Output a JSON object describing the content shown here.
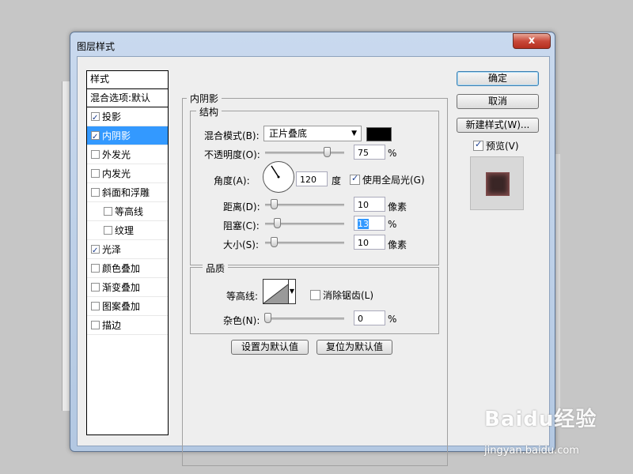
{
  "window": {
    "title": "图层样式",
    "close_label": "x"
  },
  "styles": {
    "header": "样式",
    "blend_options": "混合选项:默认",
    "items": [
      {
        "label": "投影",
        "checked": true
      },
      {
        "label": "内阴影",
        "checked": true,
        "selected": true
      },
      {
        "label": "外发光",
        "checked": false
      },
      {
        "label": "内发光",
        "checked": false
      },
      {
        "label": "斜面和浮雕",
        "checked": false
      },
      {
        "label": "等高线",
        "checked": false,
        "sub": true
      },
      {
        "label": "纹理",
        "checked": false,
        "sub": true
      },
      {
        "label": "光泽",
        "checked": true
      },
      {
        "label": "颜色叠加",
        "checked": false
      },
      {
        "label": "渐变叠加",
        "checked": false
      },
      {
        "label": "图案叠加",
        "checked": false
      },
      {
        "label": "描边",
        "checked": false
      }
    ]
  },
  "panel": {
    "title": "内阴影",
    "structure": {
      "title": "结构",
      "blend_mode_label": "混合模式(B):",
      "blend_mode_value": "正片叠底",
      "blend_color": "#000000",
      "opacity_label": "不透明度(O):",
      "opacity_value": "75",
      "opacity_unit": "%",
      "opacity_level": 0.75,
      "angle_label": "角度(A):",
      "angle_value": "120",
      "angle_unit": "度",
      "global_light_label": "使用全局光(G)",
      "global_light_checked": true,
      "distance_label": "距离(D):",
      "distance_value": "10",
      "distance_unit": "像素",
      "choke_label": "阻塞(C):",
      "choke_value": "13",
      "choke_unit": "%",
      "size_label": "大小(S):",
      "size_value": "10",
      "size_unit": "像素"
    },
    "quality": {
      "title": "品质",
      "contour_label": "等高线:",
      "antialias_label": "消除锯齿(L)",
      "antialias_checked": false,
      "noise_label": "杂色(N):",
      "noise_value": "0",
      "noise_unit": "%"
    },
    "buttons": {
      "set_default": "设置为默认值",
      "reset_default": "复位为默认值"
    }
  },
  "actions": {
    "ok": "确定",
    "cancel": "取消",
    "new_style": "新建样式(W)...",
    "preview_label": "预览(V)",
    "preview_checked": true
  },
  "watermark": {
    "logo": "Baidu经验",
    "url": "jingyan.baidu.com"
  }
}
